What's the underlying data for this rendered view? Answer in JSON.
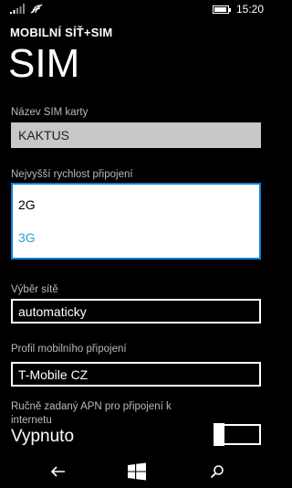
{
  "status_bar": {
    "time": "15:20",
    "icons": [
      "signal-icon",
      "wifi-icon",
      "battery-icon"
    ]
  },
  "header": {
    "app_title": "MOBILNÍ SÍŤ+SIM",
    "page_title": "SIM"
  },
  "sim_name": {
    "label": "Název SIM karty",
    "value": "KAKTUS"
  },
  "max_speed": {
    "label": "Nejvyšší rychlost připojení",
    "options": [
      "2G",
      "3G"
    ],
    "selected": "3G"
  },
  "network_selection": {
    "label": "Výběr sítě",
    "value": "automaticky"
  },
  "mobile_profile": {
    "label": "Profil mobilního připojení",
    "value": "T-Mobile CZ"
  },
  "manual_apn": {
    "label": "Ručně zadaný APN pro připojení k internetu",
    "state": "Vypnuto",
    "on": false
  },
  "nav_bar": {
    "icons": [
      "back-arrow-icon",
      "windows-start-icon",
      "search-icon"
    ]
  },
  "colors": {
    "accent": "#27a0dc",
    "dropdown_border": "#0b7fd6",
    "readonly_bg": "#c8c8c8",
    "label_gray": "#b9b9b9"
  }
}
